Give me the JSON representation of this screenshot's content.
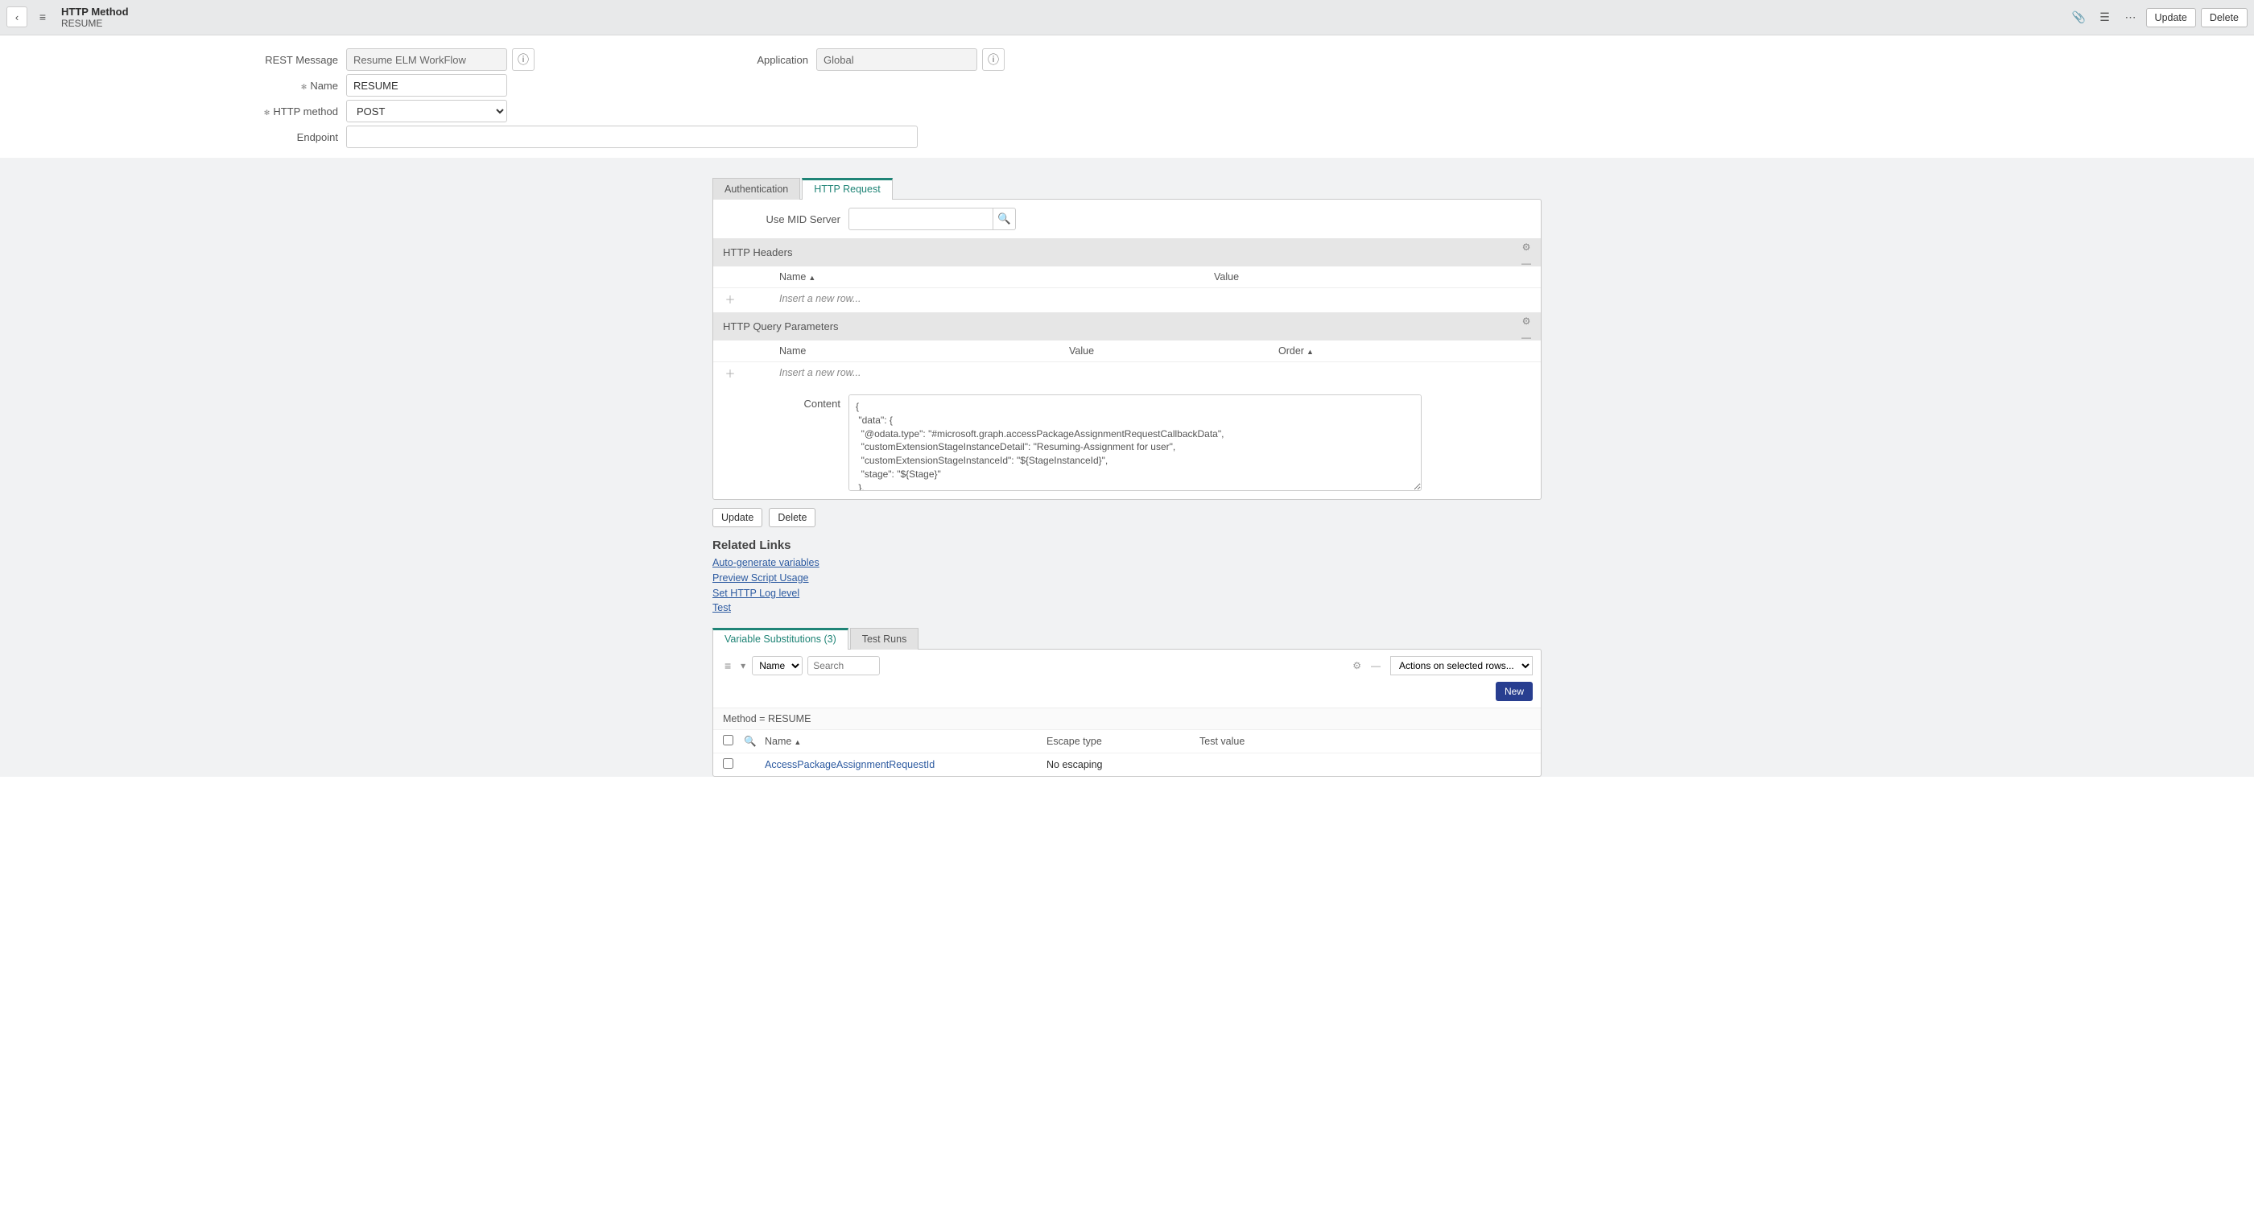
{
  "header": {
    "title": "HTTP Method",
    "subtitle": "RESUME",
    "update_label": "Update",
    "delete_label": "Delete"
  },
  "form": {
    "rest_message_label": "REST Message",
    "rest_message_value": "Resume ELM WorkFlow",
    "application_label": "Application",
    "application_value": "Global",
    "name_label": "Name",
    "name_value": "RESUME",
    "http_method_label": "HTTP method",
    "http_method_value": "POST",
    "endpoint_label": "Endpoint",
    "endpoint_value": ""
  },
  "tabs": {
    "auth": "Authentication",
    "http_request": "HTTP Request"
  },
  "request_tab": {
    "use_mid_label": "Use MID Server",
    "headers_title": "HTTP Headers",
    "headers_col_name": "Name",
    "headers_col_value": "Value",
    "insert_row_text": "Insert a new row...",
    "query_title": "HTTP Query Parameters",
    "query_col_name": "Name",
    "query_col_value": "Value",
    "query_col_order": "Order",
    "content_label": "Content",
    "content_value": "{\n \"data\": {\n  \"@odata.type\": \"#microsoft.graph.accessPackageAssignmentRequestCallbackData\",\n  \"customExtensionStageInstanceDetail\": \"Resuming-Assignment for user\",\n  \"customExtensionStageInstanceId\": \"${StageInstanceId}\",\n  \"stage\": \"${Stage}\"\n },\n \"source\": \"ServiceNow\",\n \"type\": \"microsoft.graph.accessPackageCustomExtensionStage.${Stage}\"\n}"
  },
  "buttons": {
    "update": "Update",
    "delete": "Delete"
  },
  "related_links": {
    "title": "Related Links",
    "auto_gen": "Auto-generate variables",
    "preview": "Preview Script Usage",
    "set_log": "Set HTTP Log level",
    "test": "Test"
  },
  "bottom_tabs": {
    "var_sub": "Variable Substitutions (3)",
    "test_runs": "Test Runs"
  },
  "var_list": {
    "search_field": "Name",
    "search_placeholder": "Search",
    "actions_placeholder": "Actions on selected rows...",
    "new_label": "New",
    "breadcrumb": "Method = RESUME",
    "col_name": "Name",
    "col_escape": "Escape type",
    "col_test": "Test value",
    "row1_name": "AccessPackageAssignmentRequestId",
    "row1_escape": "No escaping",
    "row1_test": ""
  }
}
